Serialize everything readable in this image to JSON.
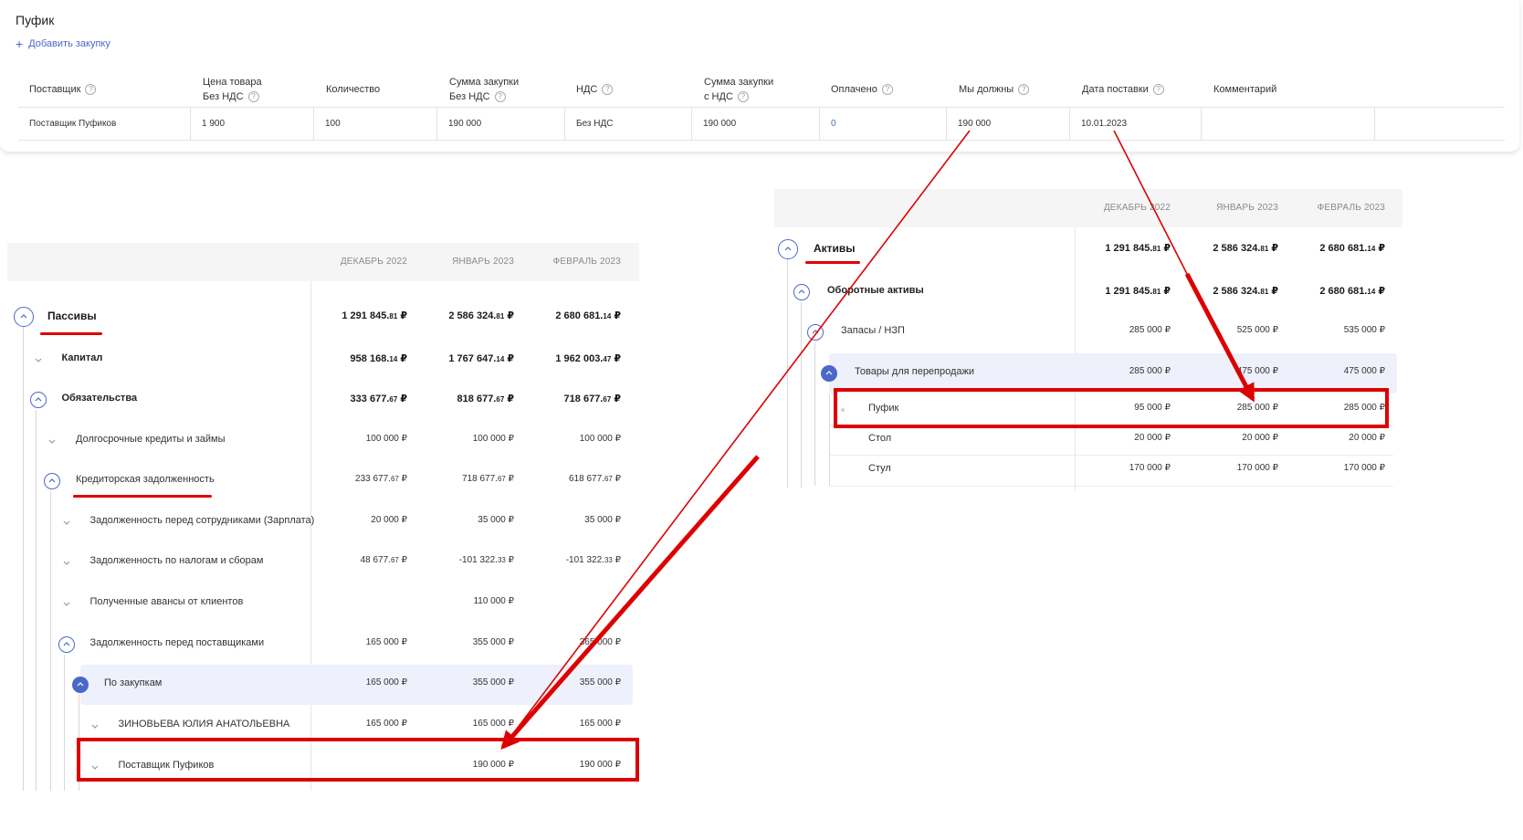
{
  "purchase": {
    "title": "Пуфик",
    "add_label": "Добавить закупку",
    "columns": [
      {
        "l1": "Поставщик",
        "l2": "",
        "q": true
      },
      {
        "l1": "Цена товара",
        "l2": "Без НДС",
        "q": true
      },
      {
        "l1": "Количество",
        "l2": "",
        "q": false
      },
      {
        "l1": "Сумма закупки",
        "l2": "Без НДС",
        "q": true
      },
      {
        "l1": "НДС",
        "l2": "",
        "q": true
      },
      {
        "l1": "Сумма закупки",
        "l2": "с НДС",
        "q": true
      },
      {
        "l1": "Оплачено",
        "l2": "",
        "q": true
      },
      {
        "l1": "Мы должны",
        "l2": "",
        "q": true
      },
      {
        "l1": "Дата поставки",
        "l2": "",
        "q": true
      },
      {
        "l1": "Комментарий",
        "l2": "",
        "q": false
      }
    ],
    "row": [
      "Поставщик Пуфиков",
      "1 900",
      "100",
      "190 000",
      "Без НДС",
      "190 000",
      "0",
      "190 000",
      "10.01.2023",
      ""
    ]
  },
  "months": [
    "ДЕКАБРЬ 2022",
    "ЯНВАРЬ 2023",
    "ФЕВРАЛЬ 2023"
  ],
  "question_glyph": "?",
  "liabilities": [
    {
      "label": "Пассивы",
      "level": 0,
      "bold": true,
      "toggle": "outline",
      "v": [
        "1 291 845.|81 ₽",
        "2 586 324.|81 ₽",
        "2 680 681.|14 ₽"
      ]
    },
    {
      "label": "Капитал",
      "level": 1,
      "bold": true,
      "toggle": "plain",
      "v": [
        "958 168.|14 ₽",
        "1 767 647.|14 ₽",
        "1 962 003.|47 ₽"
      ]
    },
    {
      "label": "Обязательства",
      "level": 1,
      "bold": true,
      "toggle": "outline",
      "v": [
        "333 677.|67 ₽",
        "818 677.|67 ₽",
        "718 677.|67 ₽"
      ]
    },
    {
      "label": "Долгосрочные кредиты и займы",
      "level": 2,
      "bold": false,
      "toggle": "plain",
      "v": [
        "100 000 ₽",
        "100 000 ₽",
        "100 000 ₽"
      ]
    },
    {
      "label": "Кредиторская задолженность",
      "level": 2,
      "bold": false,
      "toggle": "outline",
      "v": [
        "233 677.|67 ₽",
        "718 677.|67 ₽",
        "618 677.|67 ₽"
      ]
    },
    {
      "label": "Задолженность перед сотрудниками (Зарплата)",
      "level": 3,
      "bold": false,
      "toggle": "plain",
      "v": [
        "20 000 ₽",
        "35 000 ₽",
        "35 000 ₽"
      ]
    },
    {
      "label": "Задолженность по налогам и сборам",
      "level": 3,
      "bold": false,
      "toggle": "plain",
      "v": [
        "48 677.|67 ₽",
        "-101 322.|33 ₽",
        "-101 322.|33 ₽"
      ]
    },
    {
      "label": "Полученные авансы от клиентов",
      "level": 3,
      "bold": false,
      "toggle": "plain",
      "v": [
        "",
        "110 000 ₽",
        ""
      ]
    },
    {
      "label": "Задолженность перед поставщиками",
      "level": 3,
      "bold": false,
      "toggle": "outline",
      "v": [
        "165 000 ₽",
        "355 000 ₽",
        "365 000 ₽"
      ]
    },
    {
      "label": "По закупкам",
      "level": 4,
      "bold": false,
      "toggle": "solid",
      "v": [
        "165 000 ₽",
        "355 000 ₽",
        "355 000 ₽"
      ]
    },
    {
      "label": "ЗИНОВЬЕВА ЮЛИЯ АНАТОЛЬЕВНА",
      "level": 5,
      "bold": false,
      "toggle": "plain",
      "v": [
        "165 000 ₽",
        "165 000 ₽",
        "165 000 ₽"
      ]
    },
    {
      "label": "Поставщик Пуфиков",
      "level": 5,
      "bold": false,
      "toggle": "plain",
      "v": [
        "",
        "190 000 ₽",
        "190 000 ₽"
      ]
    }
  ],
  "assets": [
    {
      "label": "Активы",
      "level": 0,
      "bold": true,
      "toggle": "outline",
      "v": [
        "1 291 845.|81 ₽",
        "2 586 324.|81 ₽",
        "2 680 681.|14 ₽"
      ]
    },
    {
      "label": "Оборотные активы",
      "level": 1,
      "bold": true,
      "toggle": "outline",
      "v": [
        "1 291 845.|81 ₽",
        "2 586 324.|81 ₽",
        "2 680 681.|14 ₽"
      ]
    },
    {
      "label": "Запасы / НЗП",
      "level": 2,
      "bold": false,
      "toggle": "outline",
      "v": [
        "285 000 ₽",
        "525 000 ₽",
        "535 000 ₽"
      ]
    },
    {
      "label": "Товары для перепродажи",
      "level": 3,
      "bold": false,
      "toggle": "solid",
      "v": [
        "285 000 ₽",
        "475 000 ₽",
        "475 000 ₽"
      ]
    },
    {
      "label": "Пуфик",
      "level": 4,
      "bold": false,
      "toggle": "dot",
      "v": [
        "95 000 ₽",
        "285 000 ₽",
        "285 000 ₽"
      ]
    },
    {
      "label": "Стол",
      "level": 4,
      "bold": false,
      "toggle": "none",
      "v": [
        "20 000 ₽",
        "20 000 ₽",
        "20 000 ₽"
      ]
    },
    {
      "label": "Стул",
      "level": 4,
      "bold": false,
      "toggle": "none",
      "v": [
        "170 000 ₽",
        "170 000 ₽",
        "170 000 ₽"
      ]
    }
  ],
  "annotation_color": "#dd0000",
  "accent_color": "#4a68c9"
}
